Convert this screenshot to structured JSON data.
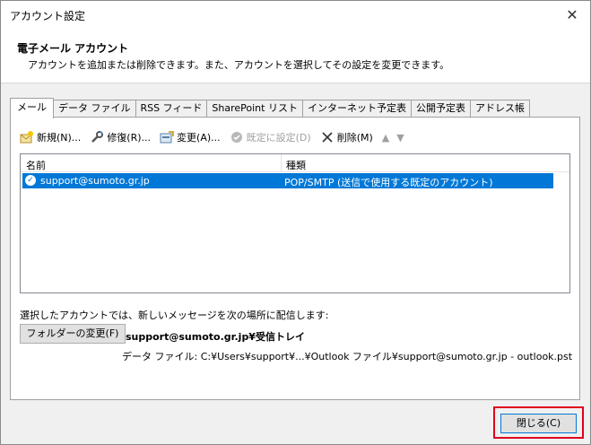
{
  "window": {
    "title": "アカウント設定",
    "close_glyph": "✕"
  },
  "header": {
    "title": "電子メール アカウント",
    "description": "アカウントを追加または削除できます。また、アカウントを選択してその設定を変更できます。"
  },
  "tabs": [
    {
      "label": "メール",
      "active": true
    },
    {
      "label": "データ ファイル"
    },
    {
      "label": "RSS フィード"
    },
    {
      "label": "SharePoint リスト"
    },
    {
      "label": "インターネット予定表"
    },
    {
      "label": "公開予定表"
    },
    {
      "label": "アドレス帳"
    }
  ],
  "toolbar": {
    "new": "新規(N)...",
    "repair": "修復(R)...",
    "change": "変更(A)...",
    "set_default": "既定に設定(D)",
    "delete": "削除(M)",
    "up": "▲",
    "down": "▼"
  },
  "list": {
    "columns": [
      "名前",
      "種類"
    ],
    "rows": [
      {
        "name": "support@sumoto.gr.jp",
        "type": "POP/SMTP (送信で使用する既定のアカウント)",
        "selected": true
      }
    ]
  },
  "delivery": {
    "label": "選択したアカウントでは、新しいメッセージを次の場所に配信します:",
    "folder_button": "フォルダーの変更(F)",
    "location": "support@sumoto.gr.jp¥受信トレイ",
    "data_file": "データ ファイル: C:¥Users¥support¥...¥Outlook ファイル¥support@sumoto.gr.jp - outlook.pst"
  },
  "footer": {
    "close_button": "閉じる(C)"
  },
  "colors": {
    "selection": "#0078d7",
    "highlight_border": "#e0001b"
  }
}
